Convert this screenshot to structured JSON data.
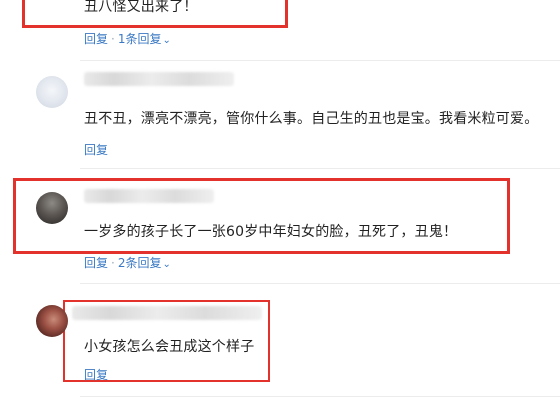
{
  "colors": {
    "annotation_red": "#e3312b",
    "link_blue": "#3b79c4",
    "text": "#222222"
  },
  "comments": [
    {
      "text": "丑八怪又出来了！",
      "reply_label": "回复",
      "replies_count": "1条回复",
      "chevron_icon": "chevron-down-icon"
    },
    {
      "text": "丑不丑，漂亮不漂亮，管你什么事。自己生的丑也是宝。我看米粒可爱。",
      "reply_label": "回复"
    },
    {
      "text": "一岁多的孩子长了一张60岁中年妇女的脸，丑死了，丑鬼！",
      "reply_label": "回复",
      "replies_count": "2条回复",
      "chevron_icon": "chevron-down-icon"
    },
    {
      "text": "小女孩怎么会丑成这个样子",
      "reply_label": "回复"
    }
  ]
}
